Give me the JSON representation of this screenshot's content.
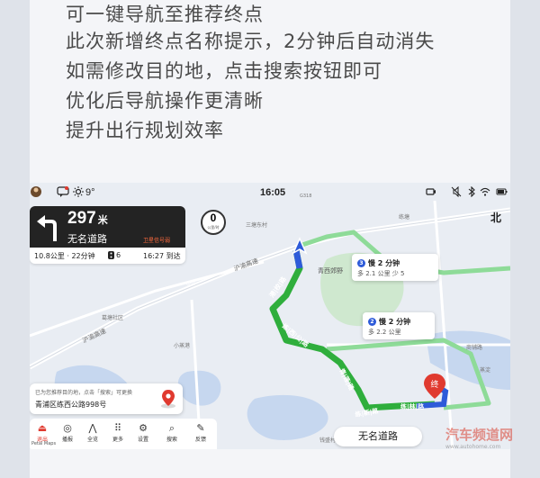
{
  "notes": [
    "可一键导航至推荐终点",
    "此次新增终点名称提示，2分钟后自动消失",
    "如需修改目的地，点击搜索按钮即可",
    "优化后导航操作更清晰",
    "提升出行规划效率"
  ],
  "status_bar": {
    "time": "16:05",
    "temperature": "9°",
    "icons": [
      "avatar-icon",
      "message-icon",
      "sun-icon",
      "camera-icon",
      "mute-icon",
      "bluetooth-icon",
      "wifi-icon",
      "battery-icon"
    ]
  },
  "guidance": {
    "distance": "297",
    "unit": "米",
    "road": "无名道路",
    "badge": "卫星信号弱",
    "remaining": "10.8公里 · 22分钟",
    "lights": "6",
    "eta": "16:27 到达"
  },
  "speed": {
    "value": "0",
    "unit": "公里/时"
  },
  "compass": "北",
  "route_options": [
    {
      "id": "3",
      "label": "慢 2 分钟",
      "detail": "多 2.1 公里 少 5"
    },
    {
      "id": "2",
      "label": "慢 2 分钟",
      "detail": "多 2.2 公里"
    }
  ],
  "map_labels": {
    "highway": "沪渝高速",
    "highway2": "沪渝高速",
    "road_g50": "G50",
    "road_g318": "G318",
    "village1": "三塘东村",
    "village2": "葛塘社区",
    "village3": "青西郊野",
    "village4": "小蒸港",
    "village5": "练塘",
    "village6": "钱盛村",
    "village7": "蒸淀",
    "village8": "商铺路",
    "road_gangxiao": "港|校|路",
    "road_lianxi": "练|西|公|路",
    "road_qinglian": "青|莲|路",
    "road_lianshen": "练|新|路",
    "road_lianlin": "练|林|路",
    "destination": "终"
  },
  "destination_card": {
    "hint": "已为您推荐目的地，点击「搜索」可更换",
    "name": "青浦区练西公路998号"
  },
  "dock": [
    {
      "label": "退出",
      "icon": "exit-icon",
      "glyph": "⏏"
    },
    {
      "label": "播报",
      "icon": "speaker-icon",
      "glyph": "◎"
    },
    {
      "label": "全览",
      "icon": "overview-icon",
      "glyph": "⋀"
    },
    {
      "label": "更多",
      "icon": "more-icon",
      "glyph": "⠿"
    },
    {
      "label": "设置",
      "icon": "settings-icon",
      "glyph": "⚙"
    },
    {
      "label": "搜索",
      "icon": "search-icon",
      "glyph": "⌕"
    },
    {
      "label": "反馈",
      "icon": "feedback-icon",
      "glyph": "✎"
    }
  ],
  "brand": "Petal Maps",
  "current_road": "无名道路",
  "watermark": {
    "text": "汽车频道网",
    "sub": "www.autohome.com"
  },
  "colors": {
    "route_main": "#2fae3c",
    "route_alt": "#7fd88a",
    "route_near": "#2e5bd9",
    "destination": "#e03a2f"
  }
}
